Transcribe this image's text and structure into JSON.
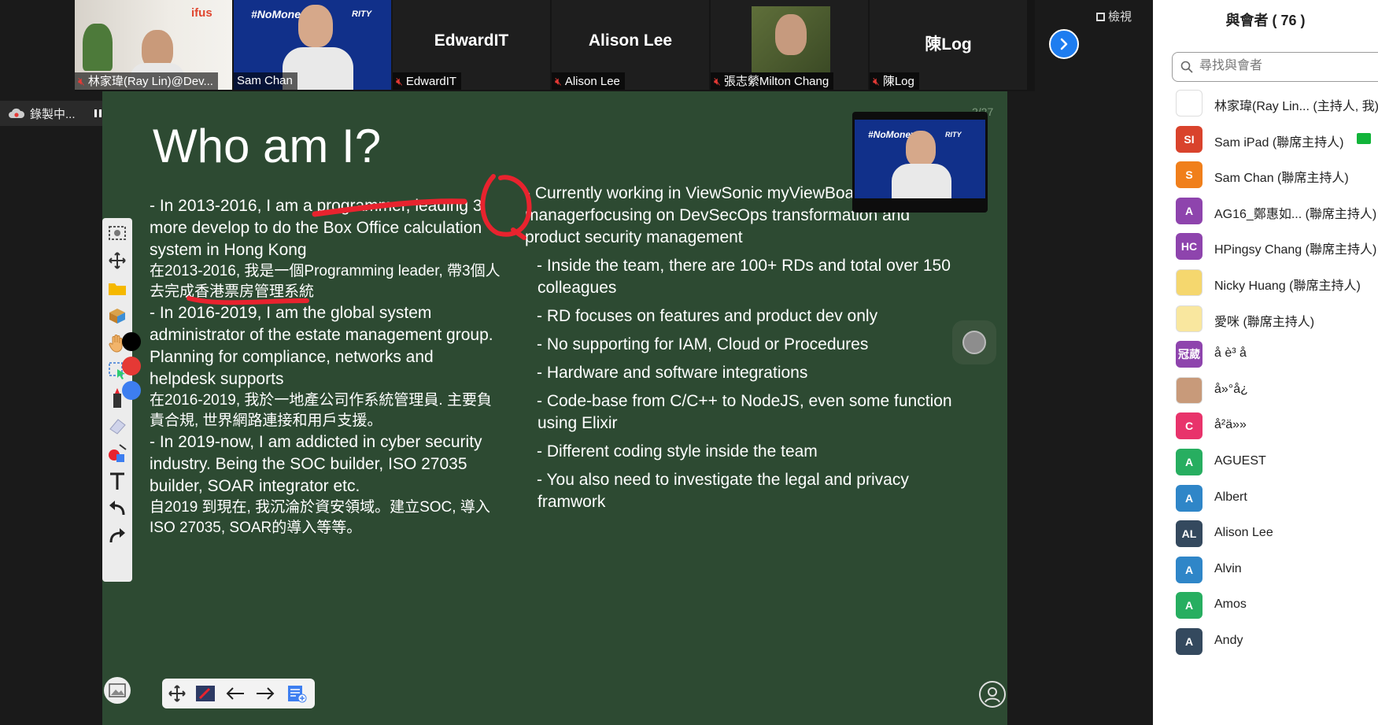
{
  "video_strip": {
    "tiles": [
      {
        "name": "林家瑋(Ray Lin)@Dev...",
        "muted": true,
        "brand_text": "ifus"
      },
      {
        "name": "Sam Chan",
        "muted": false,
        "brand_text": "#NoMoney",
        "brand_text2": "RITY"
      },
      {
        "name": "EdwardIT",
        "muted": true,
        "display": "EdwardIT"
      },
      {
        "name": "Alison Lee",
        "muted": true,
        "display": "Alison Lee"
      },
      {
        "name": "張志縈Milton Chang",
        "muted": true
      },
      {
        "name": "陳Log",
        "muted": true,
        "display": "陳Log"
      }
    ],
    "view_label": "檢視",
    "next_icon": "chevron-right-icon"
  },
  "recording": {
    "label": "錄製中..."
  },
  "slide": {
    "page_label": "2/27",
    "title": "Who am I?",
    "left_col": {
      "p1": "- In 2013-2016, I am a programmer, leading 3 more develop to do the Box Office calculation system in Hong Kong",
      "p1_zh": "在2013-2016, 我是一個Programming leader, 帶3個人去完成香港票房管理系統",
      "p2": "- In 2016-2019, I am the global system administrator of the estate management group. Planning for compliance, networks and helpdesk supports",
      "p2_zh": "在2016-2019, 我於一地產公司作系統管理員. 主要負責合規, 世界網路連接和用戶支援。",
      "p3": "- In 2019-now, I am addicted in cyber security industry. Being the SOC builder, ISO 27035 builder, SOAR integrator etc.",
      "p3_zh": "自2019 到現在, 我沉淪於資安領域。建立SOC, 導入ISO 27035, SOAR的導入等等。"
    },
    "right_col": {
      "intro": "- Currently working in ViewSonic myViewBoard as security managerfocusing on DevSecOps transformation and product security management",
      "items": [
        "- Inside the team, there are 100+ RDs and total over 150 colleagues",
        "- RD focuses on features and product dev only",
        "- No supporting for IAM, Cloud or Procedures",
        "- Hardware and software integrations",
        "- Code-base from C/C++ to NodeJS, even some function using Elixir",
        "- Different coding style inside the team",
        "- You also need to investigate the legal and privacy framwork"
      ]
    },
    "pip_brand": "#NoMoney",
    "pip_brand2": "RITY",
    "annotation_colors": [
      "#000000",
      "#e53935",
      "#3d7ef0"
    ],
    "ink_color": "#e8232e"
  },
  "participants": {
    "title": "與會者 ( 76 )",
    "search_placeholder": "尋找與會者",
    "list": [
      {
        "name": "林家瑋(Ray Lin... (主持人, 我)",
        "initials": "",
        "color": "#ffffff",
        "photo": true
      },
      {
        "name": "Sam iPad (聯席主持人)",
        "initials": "SI",
        "color": "#d9432c",
        "sharing": true
      },
      {
        "name": "Sam Chan (聯席主持人)",
        "initials": "S",
        "color": "#f07f1b"
      },
      {
        "name": "AG16_鄭惠如... (聯席主持人)",
        "initials": "A",
        "color": "#8e44ad"
      },
      {
        "name": "HPingsy Chang (聯席主持人)",
        "initials": "HC",
        "color": "#8e44ad"
      },
      {
        "name": "Nicky Huang (聯席主持人)",
        "initials": "",
        "color": "#f5d76e",
        "photo": true
      },
      {
        "name": "愛咪 (聯席主持人)",
        "initials": "",
        "color": "#f9e79f",
        "photo": true
      },
      {
        "name": "å è³ å",
        "initials": "冠葳",
        "color": "#8e44ad"
      },
      {
        "name": "å»°å¿",
        "initials": "",
        "color": "#c89a7a",
        "photo": true
      },
      {
        "name": "å²ä»»",
        "initials": "C",
        "color": "#e8336b"
      },
      {
        "name": "AGUEST",
        "initials": "A",
        "color": "#27ae60"
      },
      {
        "name": "Albert",
        "initials": "A",
        "color": "#2f86c8"
      },
      {
        "name": "Alison Lee",
        "initials": "AL",
        "color": "#34495e"
      },
      {
        "name": "Alvin",
        "initials": "A",
        "color": "#2f86c8"
      },
      {
        "name": "Amos",
        "initials": "A",
        "color": "#27ae60"
      },
      {
        "name": "Andy",
        "initials": "A",
        "color": "#34495e"
      }
    ]
  }
}
